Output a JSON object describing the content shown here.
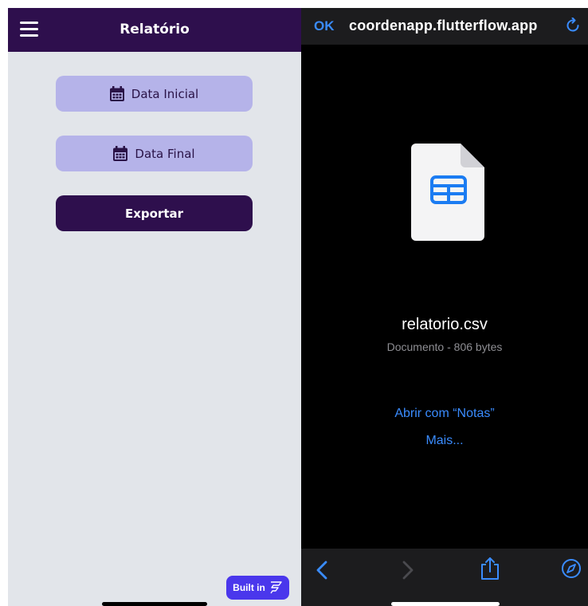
{
  "left_app": {
    "header": {
      "title": "Relatório",
      "menu_icon": "hamburger-menu-icon"
    },
    "buttons": {
      "start_date": {
        "label": "Data Inicial",
        "icon": "calendar-icon"
      },
      "end_date": {
        "label": "Data Final",
        "icon": "calendar-icon"
      },
      "export": {
        "label": "Exportar"
      }
    },
    "badge": {
      "label": "Built in",
      "icon": "flutterflow-logo-icon"
    },
    "colors": {
      "header": "#2e0f4d",
      "background": "#e2e5ea",
      "light_button": "#b5b3e9",
      "dark_button": "#2e0f4d",
      "badge": "#4a37ec"
    }
  },
  "right_app": {
    "header": {
      "ok_label": "OK",
      "url": "coordenapp.flutterflow.app",
      "reload_icon": "reload-icon"
    },
    "file": {
      "name": "relatorio.csv",
      "meta": "Documento - 806 bytes",
      "icon": "spreadsheet-file-icon"
    },
    "actions": {
      "open_with": "Abrir com “Notas”",
      "more": "Mais..."
    },
    "toolbar": {
      "back_icon": "back-chevron-icon",
      "forward_icon": "forward-chevron-icon",
      "share_icon": "share-icon",
      "safari_icon": "compass-icon"
    },
    "colors": {
      "accent": "#3a8cff",
      "background": "#000000",
      "bars": "#1c1c1e"
    }
  }
}
